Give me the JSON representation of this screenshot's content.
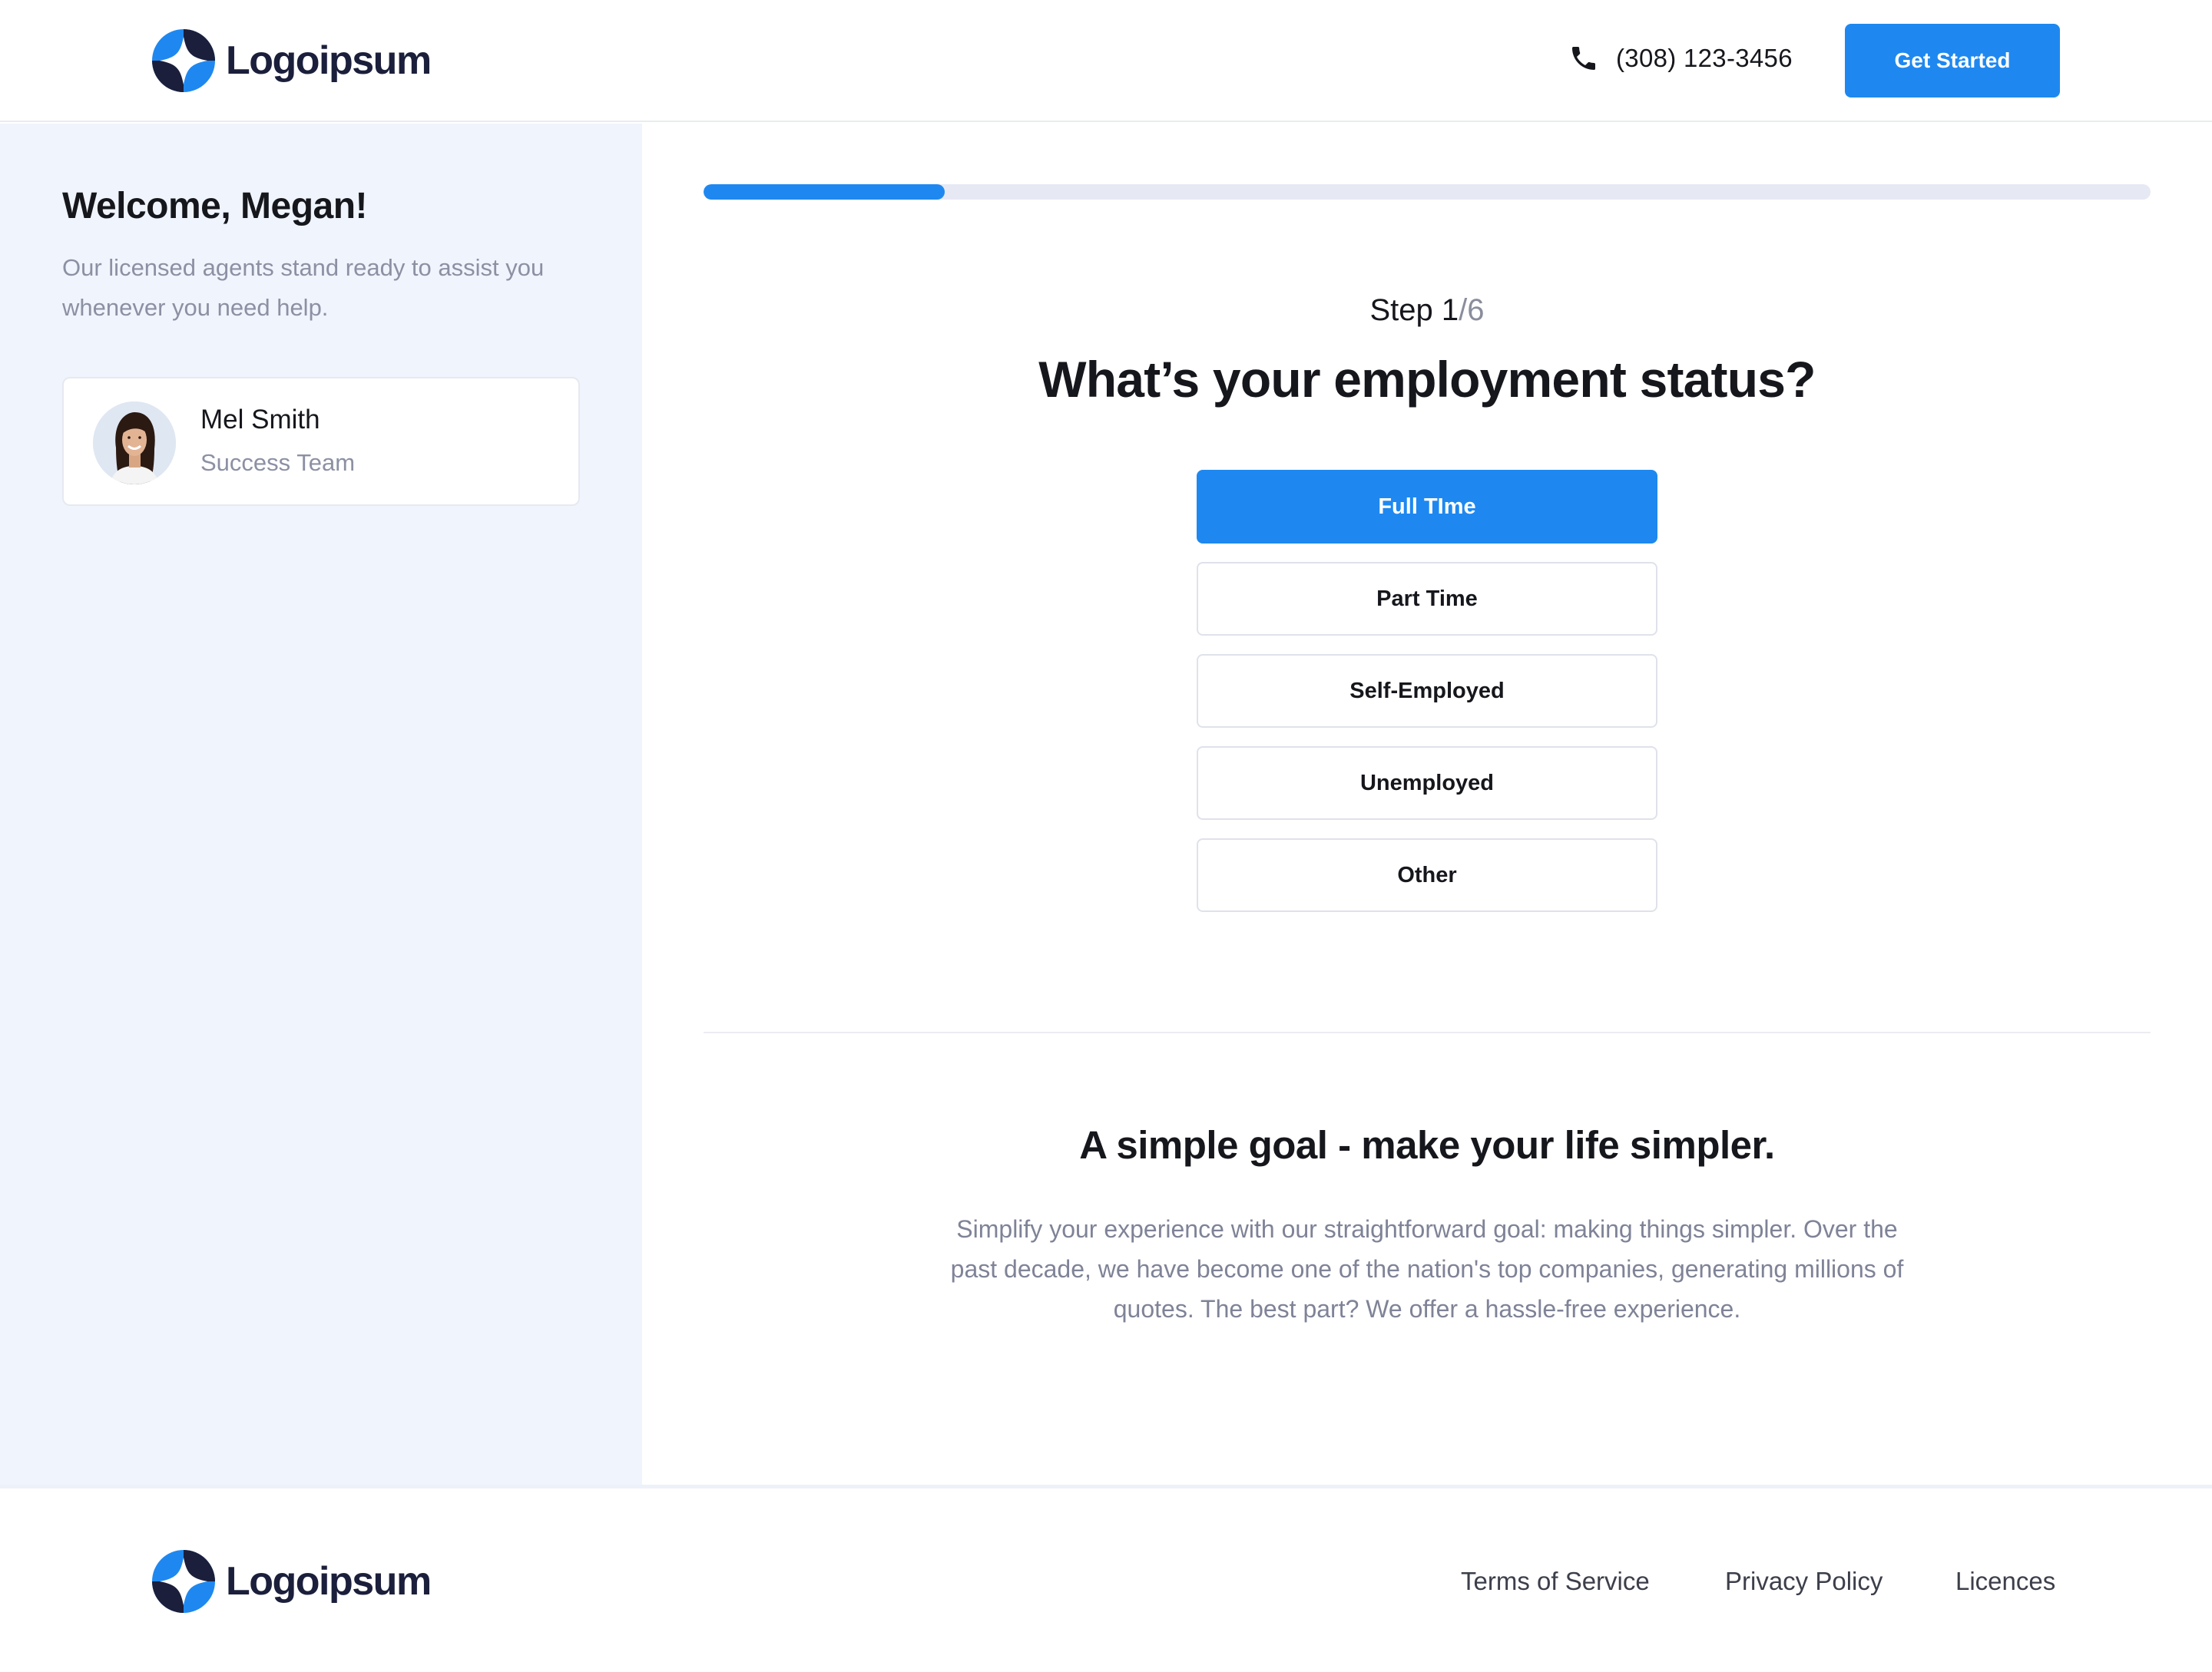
{
  "header": {
    "logo_text": "Logoipsum",
    "phone_icon": "phone-icon",
    "phone_number": "(308) 123-3456",
    "cta_label": "Get Started"
  },
  "sidebar": {
    "welcome_title": "Welcome, Megan!",
    "welcome_subtitle": "Our licensed agents stand ready to assist you whenever you need help.",
    "agent": {
      "name": "Mel Smith",
      "role": "Success Team"
    }
  },
  "main": {
    "progress": {
      "current_step": 1,
      "total_steps": 6,
      "fraction": 0.1667
    },
    "step_prefix": "Step ",
    "step_current": "1",
    "step_total": "/6",
    "question": "What’s your employment status?",
    "options": [
      {
        "label": "Full TIme",
        "selected": true
      },
      {
        "label": "Part Time",
        "selected": false
      },
      {
        "label": "Self-Employed",
        "selected": false
      },
      {
        "label": "Unemployed",
        "selected": false
      },
      {
        "label": "Other",
        "selected": false
      }
    ],
    "goal_title": "A simple goal - make your life simpler.",
    "goal_text": "Simplify your experience with our straightforward goal: making things simpler. Over the past decade, we have become one of the nation's top companies, generating millions of quotes. The best part? We offer a hassle-free experience."
  },
  "footer": {
    "logo_text": "Logoipsum",
    "links": [
      "Terms of Service",
      "Privacy Policy",
      "Licences"
    ]
  },
  "colors": {
    "accent": "#1e88f0",
    "sidebar_bg": "#f0f4fc",
    "logo_dark": "#1b1f3b"
  }
}
